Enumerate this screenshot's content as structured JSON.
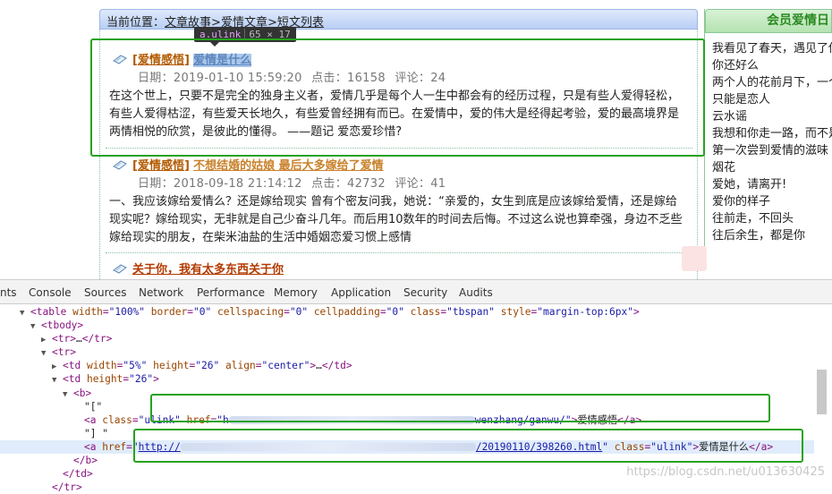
{
  "breadcrumb": {
    "prefix": "当前位置：",
    "items": [
      "文章故事",
      "爱情文章",
      "短文列表"
    ],
    "separator": ">"
  },
  "tooltip": {
    "tag": "a.ulink",
    "size": "65 × 17"
  },
  "articles": [
    {
      "category": "爱情感悟",
      "title": "爱情是什么",
      "date_label": "日期：",
      "date": "2019-01-10 15:59:20",
      "clicks_label": "点击：",
      "clicks": "16158",
      "comments_label": "评论：",
      "comments": "24",
      "excerpt": "在这个世上，只要不是完全的独身主义者，爱情几乎是每个人一生中都会有的经历过程，只是有些人爱得轻松，有些人爱得枯涩，有些爱天长地久，有些爱曾经拥有而已。在爱情中，爱的伟大是经得起考验，爱的最高境界是两情相悦的欣赏，是彼此的懂得。 ——题记 爱恋爱珍惜?"
    },
    {
      "category": "爱情感悟",
      "title": "不想结婚的姑娘 最后大多嫁给了爱情",
      "date_label": "日期：",
      "date": "2018-09-18 21:14:12",
      "clicks_label": "点击：",
      "clicks": "42732",
      "comments_label": "评论：",
      "comments": "41",
      "excerpt": "一、我应该嫁给爱情么？还是嫁给现实 曾有个密友问我，她说：“亲爱的，女生到底是应该嫁给爱情，还是嫁给现实呢？嫁给现实，无非就是自己少奋斗几年。而后用10数年的时间去后悔。不过这么说也算牵强，身边不乏些嫁给现实的朋友，在柴米油盐的生活中婚姻恋爱习惯上感情"
    },
    {
      "category": "",
      "title": "关于你，我有太多东西关于你"
    }
  ],
  "sidebar": {
    "header": "会员爱情日",
    "items": [
      "我看见了春天，遇见了你",
      "你还好么",
      "两个人的花前月下，一个",
      "只能是恋人",
      "云水谣",
      "我想和你走一路，而不是",
      "第一次尝到爱情的滋味",
      "烟花",
      "爱她，请离开!",
      "爱你的样子",
      "往前走，不回头",
      "往后余生，都是你"
    ]
  },
  "devtools": {
    "tabs": [
      "nts",
      "Console",
      "Sources",
      "Network",
      "Performance",
      "Memory",
      "Application",
      "Security",
      "Audits"
    ],
    "table_tag": {
      "width": "100%",
      "border": "0",
      "cellspacing": "0",
      "cellpadding": "0",
      "class": "tbspan",
      "style": "margin-top:6px"
    },
    "td1": {
      "width": "5%",
      "height": "26",
      "align": "center"
    },
    "td2": {
      "height": "26"
    },
    "text_open": "\"[\"",
    "text_close": "\"] \"",
    "link1": {
      "class": "ulink",
      "href_start": "h",
      "href_end": "wenzhang/ganwu/",
      "text": "爱情感悟"
    },
    "link2": {
      "href_start": "http://",
      "href_end": "/20190110/398260.html",
      "class": "ulink",
      "text": "爱情是什么"
    }
  },
  "watermark": "https://blog.csdn.net/u013630425"
}
